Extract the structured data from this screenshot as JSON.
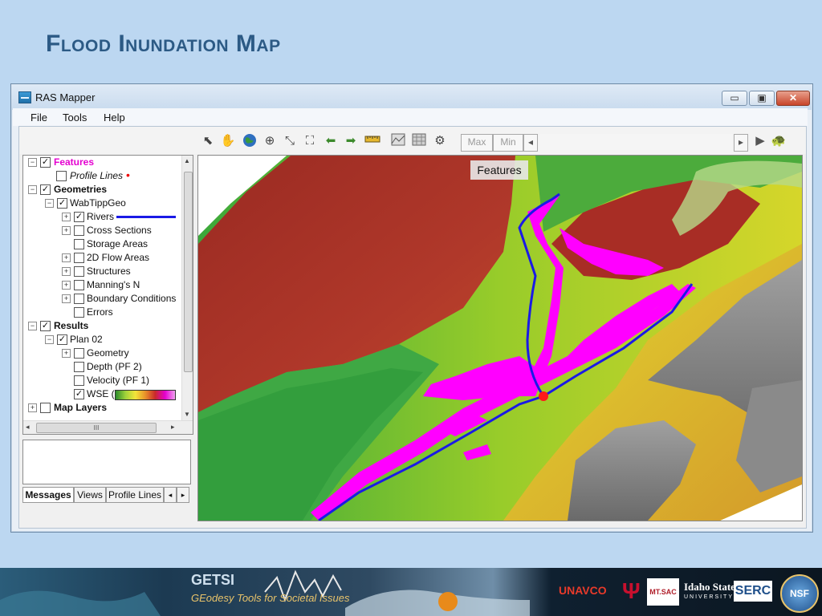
{
  "slide": {
    "title": "Flood Inundation Map"
  },
  "window": {
    "title": "RAS Mapper",
    "minimize": "▭",
    "maximize": "▣",
    "close": "✕"
  },
  "menu": [
    "File",
    "Tools",
    "Help"
  ],
  "toolbar": {
    "max_label": "Max",
    "min_label": "Min"
  },
  "tree": {
    "features": "Features",
    "profile_lines": "Profile Lines",
    "geometries": "Geometries",
    "wabtippgeo": "WabTippGeo",
    "rivers": "Rivers",
    "cross_sections": "Cross Sections",
    "storage_areas": "Storage Areas",
    "flow_areas_2d": "2D Flow Areas",
    "structures": "Structures",
    "mannings_n": "Manning's N",
    "boundary_conditions": "Boundary Conditions",
    "errors": "Errors",
    "results": "Results",
    "plan02": "Plan 02",
    "geometry": "Geometry",
    "depth": "Depth (PF 2)",
    "velocity": "Velocity (PF 1)",
    "wse": "WSE (",
    "map_layers": "Map Layers",
    "scroll_mark": "III"
  },
  "bottom_tabs": [
    "Messages",
    "Views",
    "Profile Lines"
  ],
  "map": {
    "overlay_label": "Features"
  },
  "footer": {
    "getsi": "GETSI",
    "getsi_sub": "GEodesy Tools for Societal Issues",
    "unavco": "UNAVCO",
    "mtsac": "MT.SAC",
    "idaho": "Idaho State",
    "idaho_sub": "UNIVERSITY",
    "serc": "SERC",
    "nsf": "NSF"
  },
  "colors": {
    "accent": "#2c5a85",
    "river": "#1a1ae6",
    "flood": "#ff00ff",
    "feature": "#e400d0"
  }
}
